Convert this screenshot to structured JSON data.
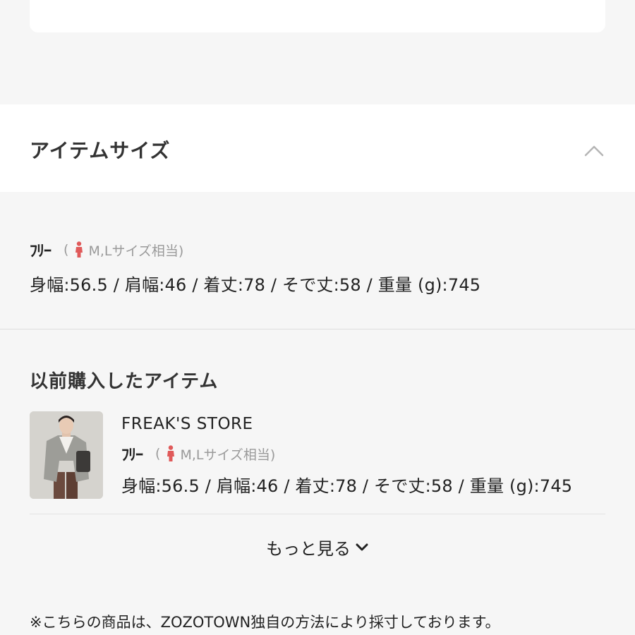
{
  "item_size": {
    "title": "アイテムサイズ",
    "size_label": "ﾌﾘｰ",
    "size_hint_open": "(",
    "size_hint_text": "M,Lサイズ相当)",
    "measurements": "身幅:56.5 / 肩幅:46 / 着丈:78 / そで丈:58 / 重量 (g):745"
  },
  "previous_purchase": {
    "title": "以前購入したアイテム",
    "brand": "FREAK'S STORE",
    "size_label": "ﾌﾘｰ",
    "size_hint_open": "(",
    "size_hint_text": "M,Lサイズ相当)",
    "measurements": "身幅:56.5 / 肩幅:46 / 着丈:78 / そで丈:58 / 重量 (g):745"
  },
  "more_label": "もっと見る",
  "note": "※こちらの商品は、ZOZOTOWN独自の方法により採寸しております。",
  "colors": {
    "person_icon": "#e05a5a",
    "background": "#f6f6f6",
    "card": "#ffffff"
  }
}
